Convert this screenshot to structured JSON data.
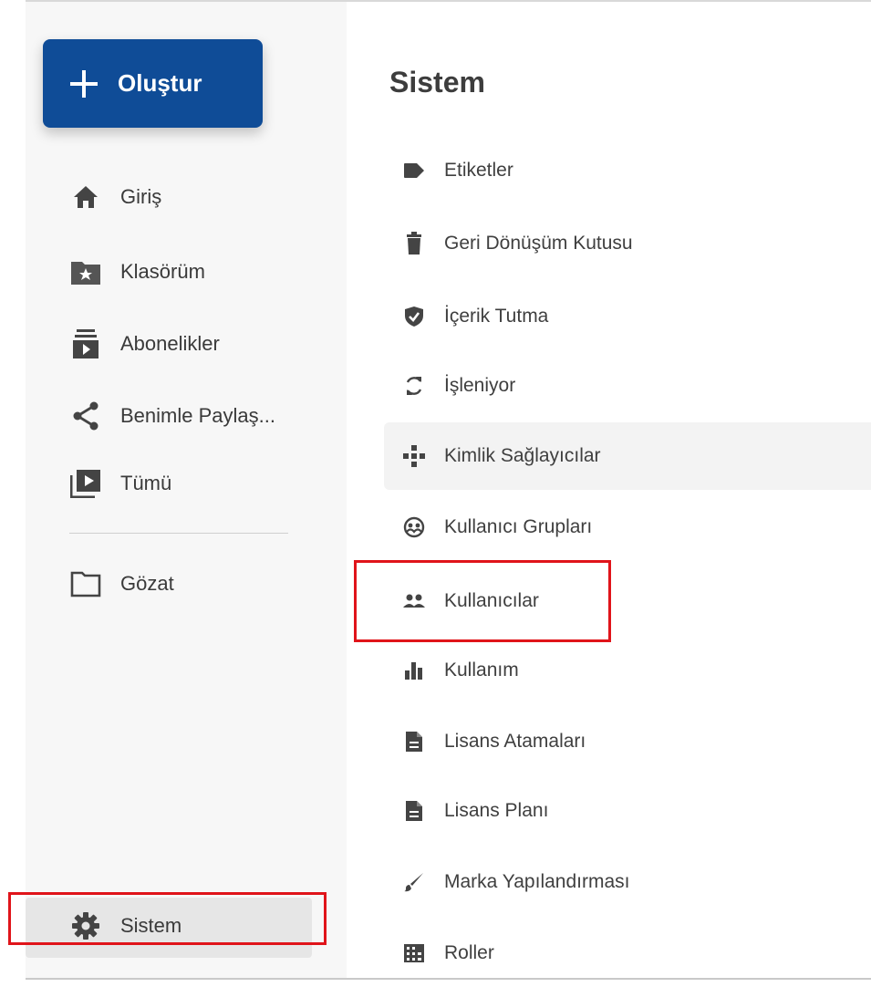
{
  "create_button": {
    "label": "Oluştur",
    "icon": "plus-icon"
  },
  "sidebar": {
    "items": [
      {
        "label": "Giriş",
        "icon": "home-icon"
      },
      {
        "label": "Klasörüm",
        "icon": "folder-star-icon"
      },
      {
        "label": "Abonelikler",
        "icon": "subscriptions-icon"
      },
      {
        "label": "Benimle Paylaş...",
        "icon": "share-icon"
      },
      {
        "label": "Tümü",
        "icon": "video-library-icon"
      },
      {
        "label": "Gözat",
        "icon": "folder-outline-icon"
      }
    ],
    "system": {
      "label": "Sistem",
      "icon": "gear-icon"
    }
  },
  "main": {
    "title": "Sistem",
    "items": [
      {
        "label": "Etiketler",
        "icon": "tag-icon"
      },
      {
        "label": "Geri Dönüşüm Kutusu",
        "icon": "trash-icon"
      },
      {
        "label": "İçerik Tutma",
        "icon": "shield-check-icon"
      },
      {
        "label": "İşleniyor",
        "icon": "sync-icon"
      },
      {
        "label": "Kimlik Sağlayıcılar",
        "icon": "identity-providers-icon"
      },
      {
        "label": "Kullanıcı Grupları",
        "icon": "user-groups-icon"
      },
      {
        "label": "Kullanıcılar",
        "icon": "users-icon"
      },
      {
        "label": "Kullanım",
        "icon": "bar-chart-icon"
      },
      {
        "label": "Lisans Atamaları",
        "icon": "document-icon"
      },
      {
        "label": "Lisans Planı",
        "icon": "document-icon"
      },
      {
        "label": "Marka Yapılandırması",
        "icon": "brush-icon"
      },
      {
        "label": "Roller",
        "icon": "building-icon"
      }
    ]
  },
  "colors": {
    "accent": "#0f4c97",
    "highlight": "#e0141a",
    "icon": "#444444"
  }
}
